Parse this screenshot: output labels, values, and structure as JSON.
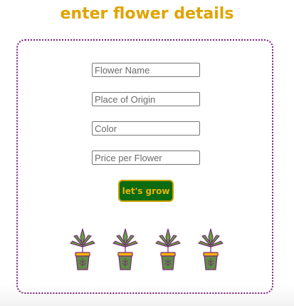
{
  "page": {
    "title": "enter flower details"
  },
  "form": {
    "fields": [
      {
        "placeholder": "Flower Name",
        "value": ""
      },
      {
        "placeholder": "Place of Origin",
        "value": ""
      },
      {
        "placeholder": "Color",
        "value": ""
      },
      {
        "placeholder": "Price per Flower",
        "value": ""
      }
    ],
    "submit_label": "let's grow"
  },
  "decorations": {
    "icon": "potted-plant-icon",
    "count": 4
  },
  "colors": {
    "title": "#e0a300",
    "border": "#7b1f7a",
    "button_bg": "#0b6b12",
    "button_text": "#e8b400",
    "leaf": "#5aa832",
    "pot": "#5f8d47",
    "pot_rim": "#f5b400",
    "outline": "#7a2a7a"
  }
}
